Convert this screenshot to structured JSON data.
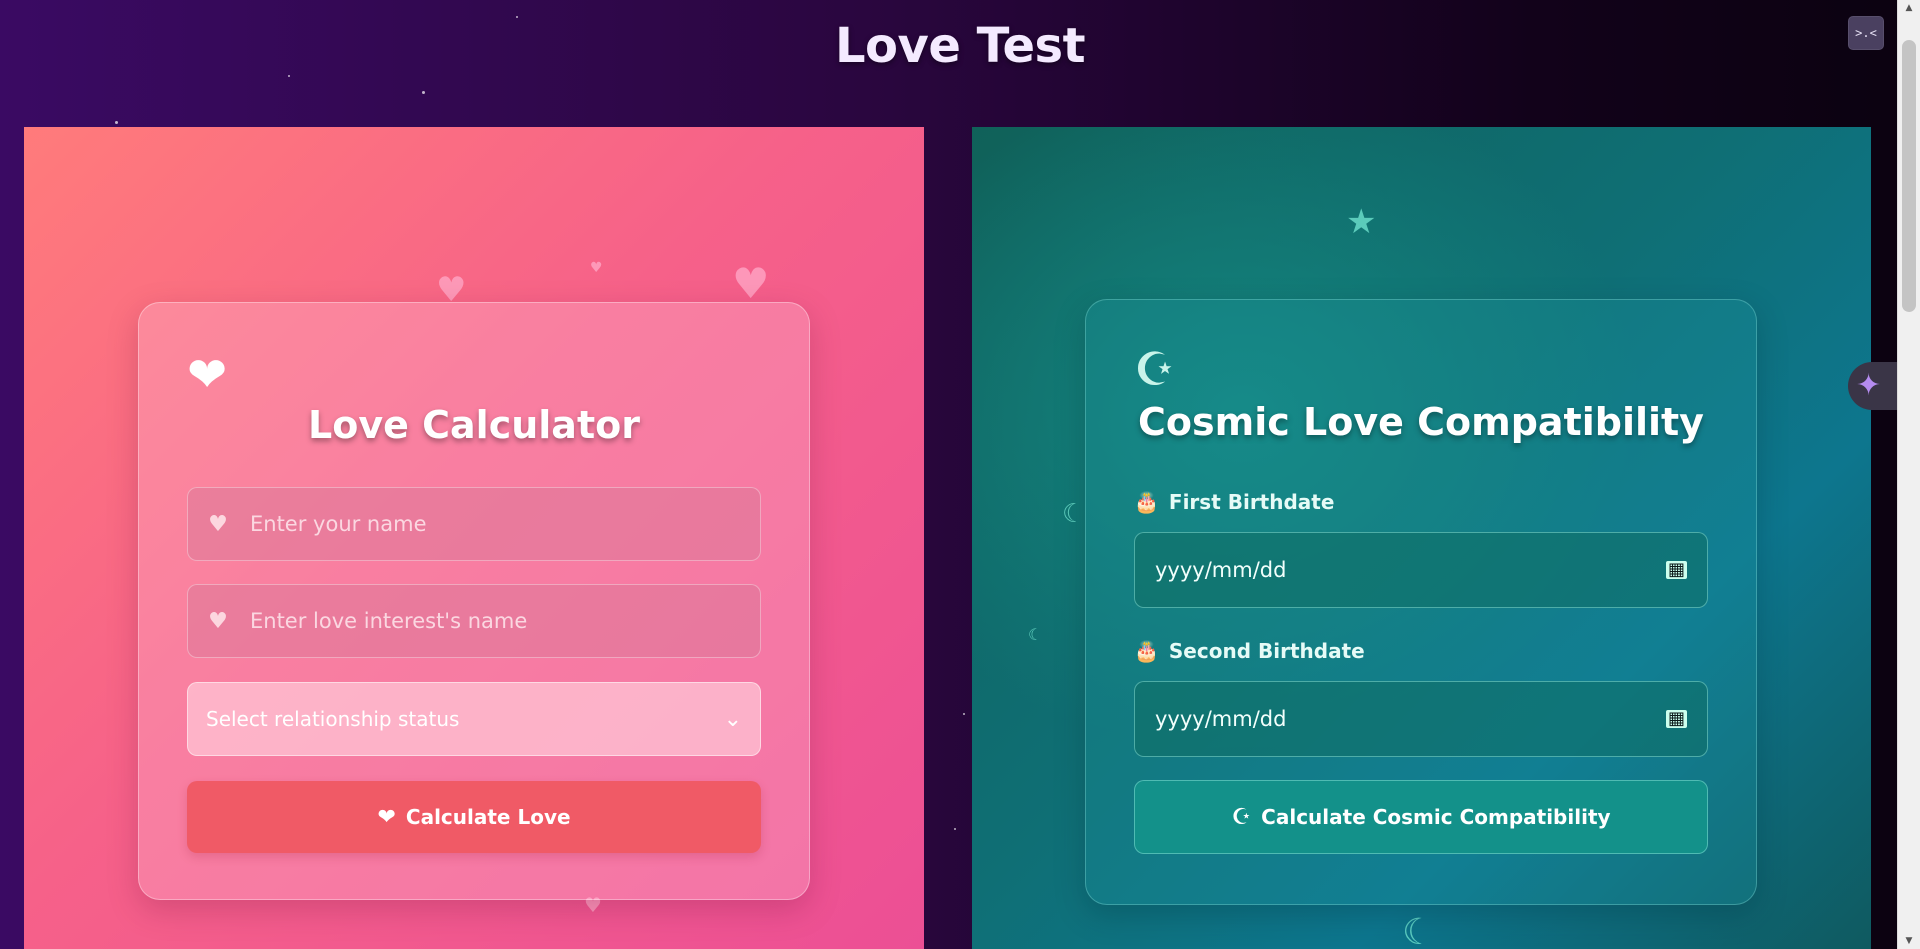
{
  "page": {
    "title": "Love Test"
  },
  "toolbar": {
    "corner_button_label": ">.<"
  },
  "love_calculator": {
    "icon": "heart-icon",
    "title": "Love Calculator",
    "name_placeholder": "Enter your name",
    "interest_placeholder": "Enter love interest's name",
    "status_select_value": "Select relationship status",
    "button_label": "Calculate Love"
  },
  "cosmic_compatibility": {
    "icon": "moon-star-icon",
    "title": "Cosmic Love Compatibility",
    "first_label": "First Birthdate",
    "first_value": "yyyy/mm/dd",
    "second_label": "Second Birthdate",
    "second_value": "yyyy/mm/dd",
    "button_label": "Calculate Cosmic Compatibility"
  },
  "colors": {
    "love_button": "#f05a66",
    "cosmic_button": "#13918a",
    "background": "#3a0a63"
  }
}
